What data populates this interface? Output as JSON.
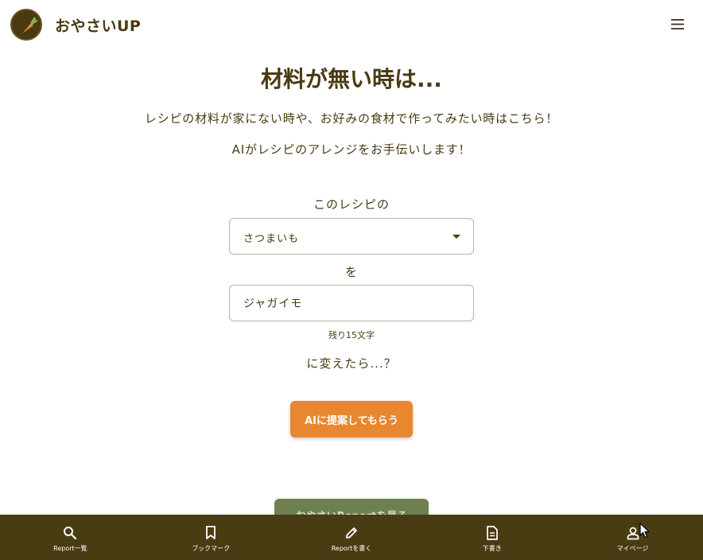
{
  "header": {
    "app_title": "おやさいUP",
    "logo_icon": "carrot-logo-icon",
    "menu_icon": "hamburger-menu-icon"
  },
  "main": {
    "title": "材料が無い時は...",
    "description_1": "レシピの材料が家にない時や、お好みの食材で作ってみたい時はこちら！",
    "description_2": "AIがレシピのアレンジをお手伝いします！",
    "recipe_label": "このレシピの",
    "select_value": "さつまいも",
    "wo_label": "を",
    "input_value": "ジャガイモ",
    "counter": "残り15文字",
    "change_label": "に変えたら...？",
    "ai_button_label": "AIに提案してもらう",
    "green_button_label": "おやさいReportを見る"
  },
  "bottom_nav": {
    "items": [
      {
        "label": "Report一覧",
        "icon": "search-icon"
      },
      {
        "label": "ブックマーク",
        "icon": "bookmark-icon"
      },
      {
        "label": "Reportを書く",
        "icon": "pencil-icon"
      },
      {
        "label": "下書き",
        "icon": "document-icon"
      },
      {
        "label": "マイページ",
        "icon": "person-icon"
      }
    ]
  },
  "colors": {
    "brand_brown": "#4a3c12",
    "accent_orange": "#e8872f",
    "accent_green": "#6f8050"
  }
}
